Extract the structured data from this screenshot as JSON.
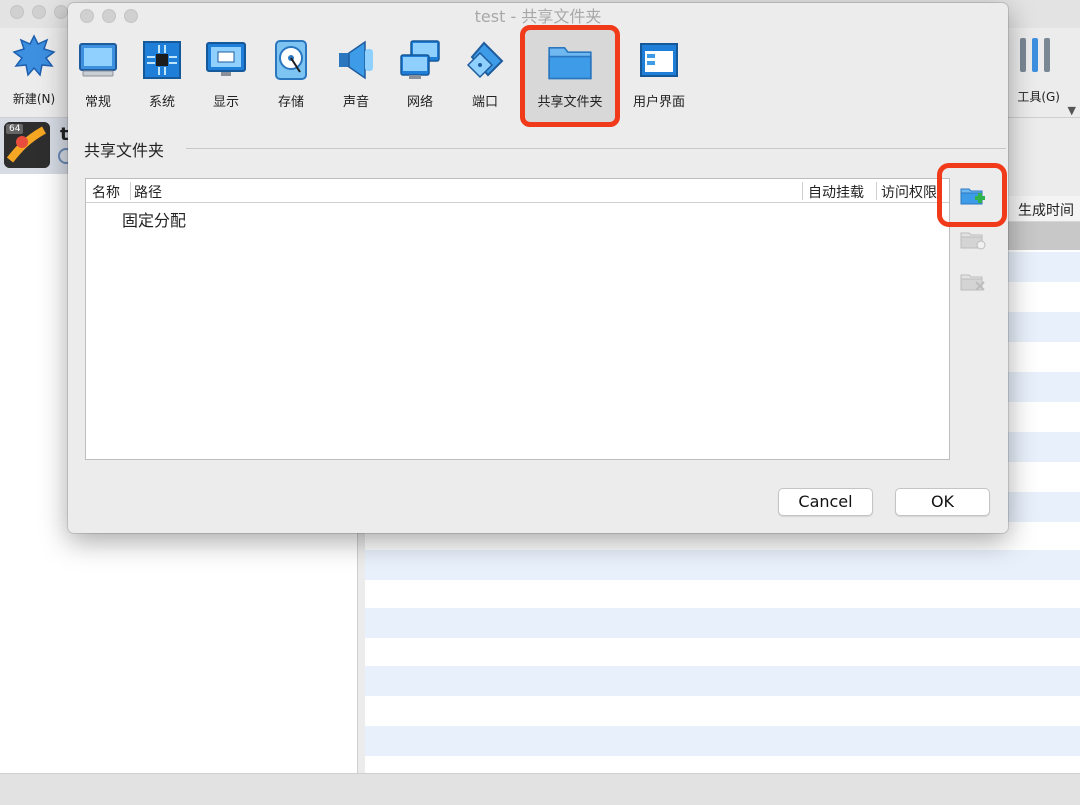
{
  "background_window": {
    "toolbar": {
      "new_label": "新建(N)",
      "tools_label": "工具(G)"
    },
    "vm_list": {
      "selected_vm_name": "t",
      "badge": "64"
    },
    "snapshot_table": {
      "column_label": "生成时间"
    }
  },
  "dialog": {
    "title": "test - 共享文件夹",
    "tabs": [
      {
        "label": "常规",
        "icon": "monitor-icon"
      },
      {
        "label": "系统",
        "icon": "chip-icon"
      },
      {
        "label": "显示",
        "icon": "display-icon"
      },
      {
        "label": "存储",
        "icon": "disk-icon"
      },
      {
        "label": "声音",
        "icon": "speaker-icon"
      },
      {
        "label": "网络",
        "icon": "network-icon"
      },
      {
        "label": "端口",
        "icon": "port-icon"
      },
      {
        "label": "共享文件夹",
        "icon": "folder-icon"
      },
      {
        "label": "用户界面",
        "icon": "window-icon"
      }
    ],
    "active_tab": "共享文件夹",
    "section_title": "共享文件夹",
    "table": {
      "columns": [
        "名称",
        "路径",
        "自动挂载",
        "访问权限"
      ],
      "rows": [
        {
          "label": "固定分配"
        }
      ]
    },
    "side_buttons": {
      "add": "add-shared-folder-icon",
      "edit": "edit-shared-folder-icon",
      "remove": "remove-shared-folder-icon"
    },
    "buttons": {
      "cancel": "Cancel",
      "ok": "OK"
    },
    "highlight_color": "#f03a1a"
  }
}
